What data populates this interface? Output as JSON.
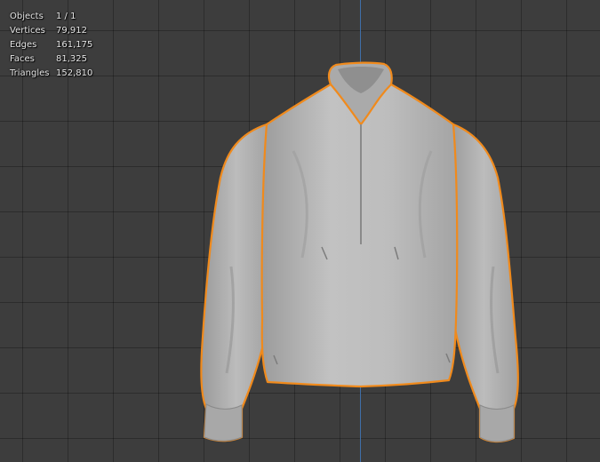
{
  "viewport": {
    "background_color": "#3d3d3d",
    "grid_color": "#2f2f2f",
    "axis_color": "#3f6fa8"
  },
  "stats": [
    {
      "label": "Objects",
      "value": "1 / 1"
    },
    {
      "label": "Vertices",
      "value": "79,912"
    },
    {
      "label": "Edges",
      "value": "161,175"
    },
    {
      "label": "Faces",
      "value": "81,325"
    },
    {
      "label": "Triangles",
      "value": "152,810"
    }
  ],
  "selected_object": {
    "outline_color": "#f08a1c",
    "mesh_color": "#b9b9b9"
  }
}
